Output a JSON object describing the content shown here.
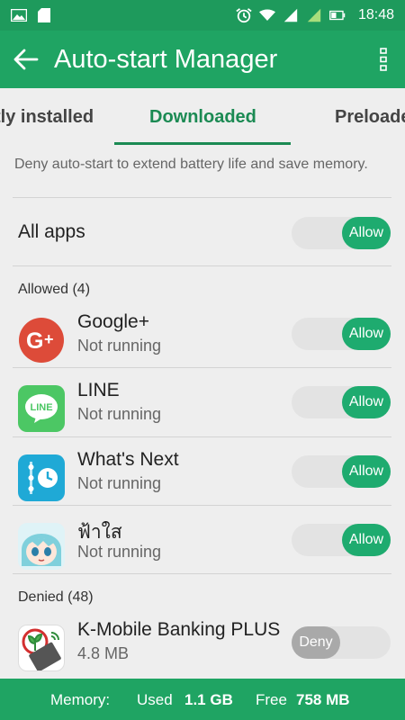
{
  "status_bar": {
    "time": "18:48",
    "icons": [
      "image-icon",
      "sd-card-icon",
      "alarm-icon",
      "wifi-icon",
      "signal-icon-1",
      "signal-icon-2",
      "battery-icon"
    ]
  },
  "app_bar": {
    "title": "Auto-start Manager"
  },
  "tabs": [
    {
      "label": "tly installed",
      "active": false
    },
    {
      "label": "Downloaded",
      "active": true
    },
    {
      "label": "Preloade",
      "active": false
    }
  ],
  "hint": "Deny auto-start to extend battery life and save memory.",
  "all_apps": {
    "label": "All apps",
    "toggle_label": "Allow",
    "state": "on"
  },
  "sections": {
    "allowed": "Allowed (4)",
    "denied": "Denied (48)"
  },
  "apps": [
    {
      "name": "Google+",
      "status": "Not running",
      "toggle_label": "Allow",
      "state": "on",
      "icon": "google-plus-icon"
    },
    {
      "name": "LINE",
      "status": "Not running",
      "toggle_label": "Allow",
      "state": "on",
      "icon": "line-icon",
      "icon_text": "LINE"
    },
    {
      "name": "What's Next",
      "status": "Not running",
      "toggle_label": "Allow",
      "state": "on",
      "icon": "whats-next-icon"
    },
    {
      "name": "ฟ้าใส",
      "status": "Not running",
      "toggle_label": "Allow",
      "state": "on",
      "icon": "anime-character-icon"
    },
    {
      "name": "K-Mobile Banking PLUS",
      "status": "4.8 MB",
      "toggle_label": "Deny",
      "state": "off",
      "icon": "k-mobile-banking-icon"
    }
  ],
  "bottom_bar": {
    "memory_label": "Memory:",
    "used_label": "Used",
    "used_value": "1.1 GB",
    "free_label": "Free",
    "free_value": "758 MB"
  },
  "colors": {
    "primary": "#1fa463",
    "accent": "#1eab6f",
    "tab_active": "#1b8a53",
    "toggle_off": "#a9a9a9"
  }
}
